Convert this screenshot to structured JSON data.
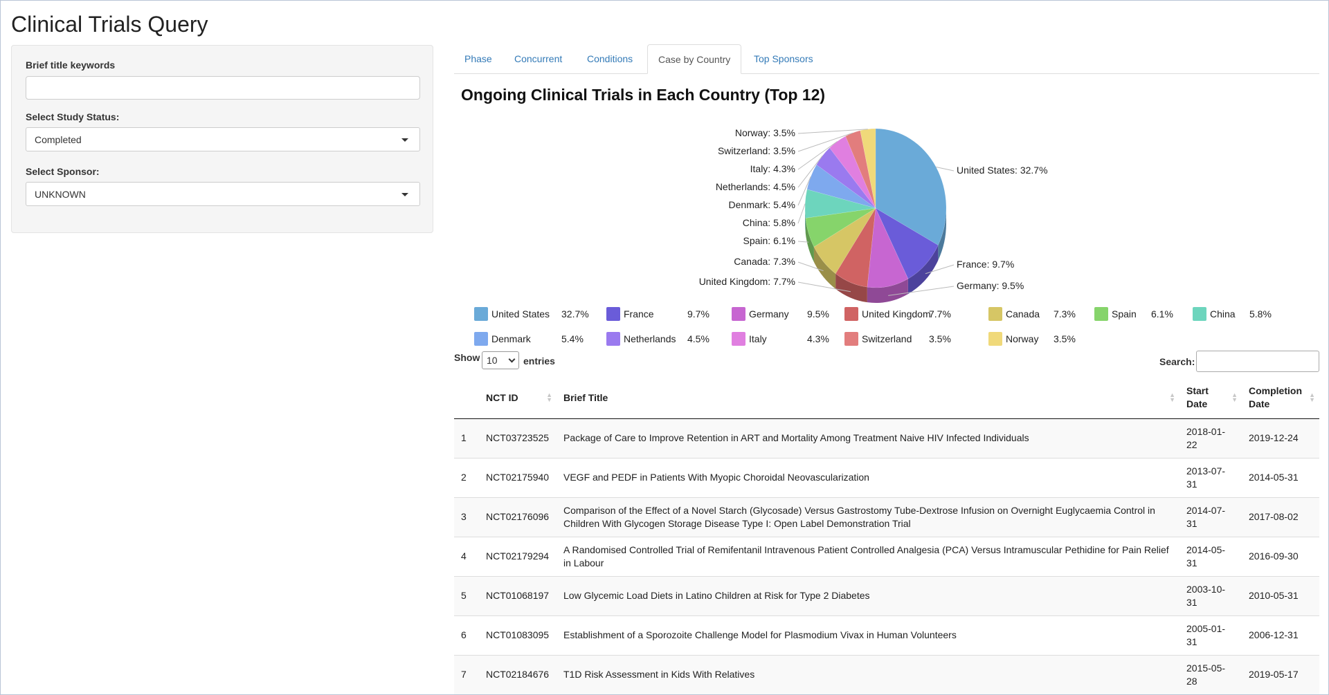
{
  "app": {
    "title": "Clinical Trials Query"
  },
  "sidebar": {
    "keyword_label": "Brief title keywords",
    "keyword_value": "",
    "status_label": "Select Study Status:",
    "status_value": "Completed",
    "sponsor_label": "Select Sponsor:",
    "sponsor_value": "UNKNOWN"
  },
  "tabs": [
    {
      "label": "Phase"
    },
    {
      "label": "Concurrent"
    },
    {
      "label": "Conditions"
    },
    {
      "label": "Case by Country",
      "active": true
    },
    {
      "label": "Top Sponsors"
    }
  ],
  "chart_data": {
    "type": "pie",
    "title": "Ongoing Clinical Trials in Each Country (Top 12)",
    "slices": [
      {
        "name": "United States",
        "value": 32.7,
        "label": "United States: 32.7%",
        "legend_pct": "32.7%",
        "color": "#6aaad8"
      },
      {
        "name": "France",
        "value": 9.7,
        "label": "France: 9.7%",
        "legend_pct": "9.7%",
        "color": "#6a5cd9"
      },
      {
        "name": "Germany",
        "value": 9.5,
        "label": "Germany: 9.5%",
        "legend_pct": "9.5%",
        "color": "#c766d1"
      },
      {
        "name": "United Kingdom",
        "value": 7.7,
        "label": "United Kingdom: 7.7%",
        "legend_pct": "7.7%",
        "color": "#d06363"
      },
      {
        "name": "Canada",
        "value": 7.3,
        "label": "Canada: 7.3%",
        "legend_pct": "7.3%",
        "color": "#d6c665"
      },
      {
        "name": "Spain",
        "value": 6.1,
        "label": "Spain: 6.1%",
        "legend_pct": "6.1%",
        "color": "#86d46b"
      },
      {
        "name": "China",
        "value": 5.8,
        "label": "China: 5.8%",
        "legend_pct": "5.8%",
        "color": "#6dd5bd"
      },
      {
        "name": "Denmark",
        "value": 5.4,
        "label": "Denmark: 5.4%",
        "legend_pct": "5.4%",
        "color": "#7ea9ee"
      },
      {
        "name": "Netherlands",
        "value": 4.5,
        "label": "Netherlands: 4.5%",
        "legend_pct": "4.5%",
        "color": "#9a7aef"
      },
      {
        "name": "Italy",
        "value": 4.3,
        "label": "Italy: 4.3%",
        "legend_pct": "4.3%",
        "color": "#e07fe0"
      },
      {
        "name": "Switzerland",
        "value": 3.5,
        "label": "Switzerland: 3.5%",
        "legend_pct": "3.5%",
        "color": "#e27d7d"
      },
      {
        "name": "Norway",
        "value": 3.5,
        "label": "Norway: 3.5%",
        "legend_pct": "3.5%",
        "color": "#f0d97a"
      }
    ]
  },
  "table_controls": {
    "show_label": "Show",
    "page_length": "10",
    "entries_label": "entries",
    "search_label": "Search:",
    "search_value": ""
  },
  "table": {
    "columns": [
      "",
      "NCT ID",
      "Brief Title",
      "Start Date",
      "Completion Date"
    ],
    "rows": [
      [
        "1",
        "NCT03723525",
        "Package of Care to Improve Retention in ART and Mortality Among Treatment Naive HIV Infected Individuals",
        "2018-01-22",
        "2019-12-24"
      ],
      [
        "2",
        "NCT02175940",
        "VEGF and PEDF in Patients With Myopic Choroidal Neovascularization",
        "2013-07-31",
        "2014-05-31"
      ],
      [
        "3",
        "NCT02176096",
        "Comparison of the Effect of a Novel Starch (Glycosade) Versus Gastrostomy Tube-Dextrose Infusion on Overnight Euglycaemia Control in Children With Glycogen Storage Disease Type I: Open Label Demonstration Trial",
        "2014-07-31",
        "2017-08-02"
      ],
      [
        "4",
        "NCT02179294",
        "A Randomised Controlled Trial of Remifentanil Intravenous Patient Controlled Analgesia (PCA) Versus Intramuscular Pethidine for Pain Relief in Labour",
        "2014-05-31",
        "2016-09-30"
      ],
      [
        "5",
        "NCT01068197",
        "Low Glycemic Load Diets in Latino Children at Risk for Type 2 Diabetes",
        "2003-10-31",
        "2010-05-31"
      ],
      [
        "6",
        "NCT01083095",
        "Establishment of a Sporozoite Challenge Model for Plasmodium Vivax in Human Volunteers",
        "2005-01-31",
        "2006-12-31"
      ],
      [
        "7",
        "NCT02184676",
        "T1D Risk Assessment in Kids With Relatives",
        "2015-05-28",
        "2019-05-17"
      ]
    ]
  }
}
